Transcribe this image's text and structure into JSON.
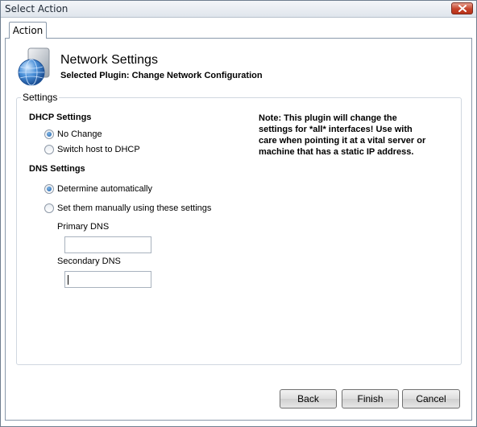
{
  "window": {
    "title": "Select Action"
  },
  "tabs": [
    {
      "label": "Action"
    }
  ],
  "header": {
    "title": "Network Settings",
    "subtitle": "Selected Plugin: Change Network Configuration",
    "icon": "network-globe-icon"
  },
  "settings": {
    "legend": "Settings",
    "dhcp": {
      "heading": "DHCP Settings",
      "options": [
        {
          "label": "No Change",
          "checked": true
        },
        {
          "label": "Switch host to DHCP",
          "checked": false
        }
      ]
    },
    "dns": {
      "heading": "DNS Settings",
      "options": [
        {
          "label": "Determine automatically",
          "checked": true
        },
        {
          "label": "Set them manually using these settings",
          "checked": false
        }
      ],
      "primary_label": "Primary DNS",
      "primary_value": "",
      "secondary_label": "Secondary DNS",
      "secondary_value": ""
    },
    "note": "Note: This plugin will change the settings for *all* interfaces! Use with care when pointing it at a vital server or machine that has a static IP address."
  },
  "buttons": {
    "back": "Back",
    "finish": "Finish",
    "cancel": "Cancel"
  },
  "colors": {
    "close_button": "#c5432a",
    "radio_selected": "#1f5fa8",
    "title_text": "#1d2733"
  }
}
